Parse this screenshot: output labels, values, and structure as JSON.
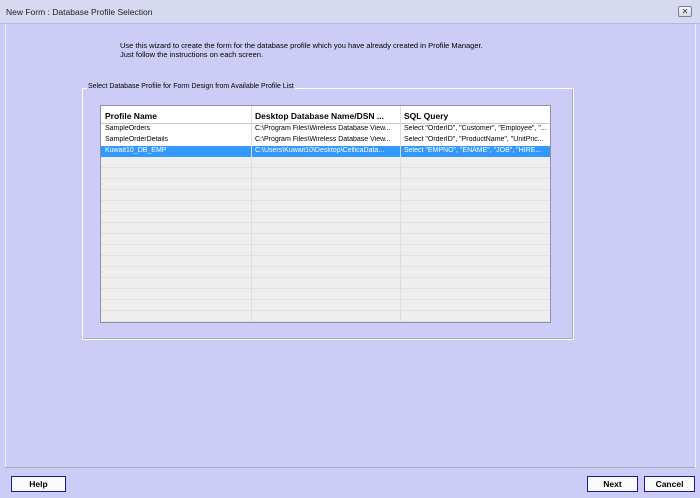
{
  "window": {
    "title": "New Form : Database Profile Selection",
    "close_glyph": "✕"
  },
  "intro": {
    "line1": "Use this wizard to create the form for the database profile which you have already created in Profile Manager.",
    "line2": "Just follow the instructions on each screen."
  },
  "group": {
    "legend": "Select Database Profile for Form Design from Available Profile  List"
  },
  "table": {
    "columns": [
      "Profile Name",
      "Desktop Database Name/DSN ...",
      "SQL Query"
    ],
    "rows": [
      {
        "profile": "SampleOrders",
        "database": "C:\\Program Files\\Wireless Database View...",
        "query": "Select \"OrderID\", \"Customer\", \"Employee\", \"..."
      },
      {
        "profile": "SampleOrderDetails",
        "database": "C:\\Program Files\\Wireless Database View...",
        "query": "Select \"OrderID\", \"ProductName\", \"UnitPric..."
      },
      {
        "profile": "Kuwait10_DB_EMP",
        "database": "C:\\Users\\Kuwait10\\Desktop\\CellicaData...",
        "query": "Select \"EMPNO\", \"ENAME\", \"JOB\", \"HIRE...",
        "selected": true
      }
    ]
  },
  "buttons": {
    "help": "Help",
    "next": "Next",
    "cancel": "Cancel"
  }
}
